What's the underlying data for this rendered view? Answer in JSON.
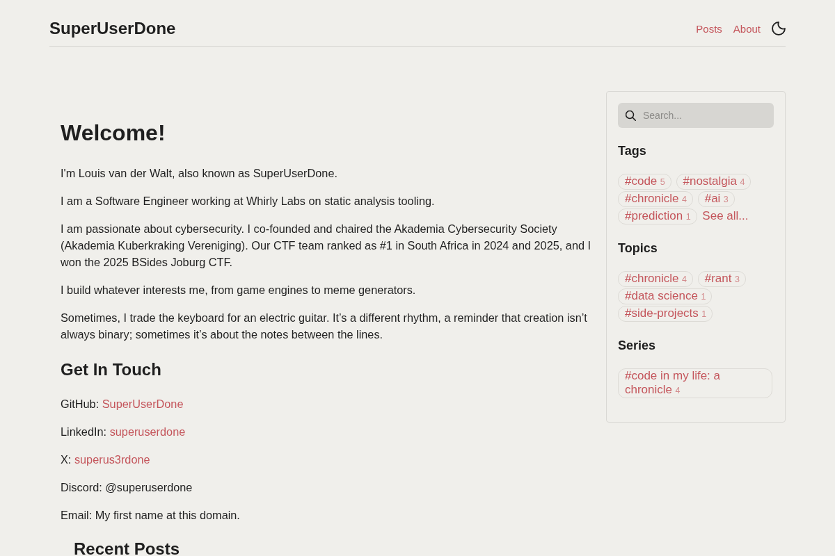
{
  "header": {
    "site_title": "SuperUserDone",
    "nav": [
      {
        "label": "Posts"
      },
      {
        "label": "About"
      }
    ]
  },
  "main": {
    "title": "Welcome!",
    "intro": [
      "I'm Louis van der Walt, also known as SuperUserDone.",
      "I am a Software Engineer working at Whirly Labs on static analysis tooling.",
      "I am passionate about cybersecurity. I co-founded and chaired the Akademia Cybersecurity Society (Akademia Kuberkraking Vereniging). Our CTF team ranked as #1 in South Africa in 2024 and 2025, and I won the 2025 BSides Joburg CTF.",
      "I build whatever interests me, from game engines to meme generators.",
      "Sometimes, I trade the keyboard for an electric guitar. It’s a different rhythm, a reminder that creation isn’t always binary; sometimes it’s about the notes between the lines."
    ],
    "contact": {
      "heading": "Get In Touch",
      "items": [
        {
          "label": "GitHub:",
          "value": "SuperUserDone",
          "kind": "link"
        },
        {
          "label": "LinkedIn:",
          "value": "superuserdone",
          "kind": "link"
        },
        {
          "label": "X:",
          "value": "superus3rdone",
          "kind": "link"
        },
        {
          "label": "Discord:",
          "value": "@superuserdone",
          "kind": "text"
        },
        {
          "label": "Email:",
          "value": "My first name at this domain.",
          "kind": "text"
        }
      ]
    },
    "recent_posts": {
      "heading": "Recent Posts"
    }
  },
  "sidebar": {
    "search": {
      "placeholder": "Search..."
    },
    "sections": [
      {
        "title": "Tags",
        "tags": [
          {
            "name": "#code",
            "count": "5"
          },
          {
            "name": "#nostalgia",
            "count": "4"
          },
          {
            "name": "#chronicle",
            "count": "4"
          },
          {
            "name": "#ai",
            "count": "3"
          },
          {
            "name": "#prediction",
            "count": "1"
          }
        ],
        "see_all": "See all..."
      },
      {
        "title": "Topics",
        "tags": [
          {
            "name": "#chronicle",
            "count": "4"
          },
          {
            "name": "#rant",
            "count": "3"
          },
          {
            "name": "#data science",
            "count": "1"
          },
          {
            "name": "#side-projects",
            "count": "1"
          }
        ]
      },
      {
        "title": "Series",
        "tags": [
          {
            "name": "#code in my life: a chronicle",
            "count": "4"
          }
        ]
      }
    ]
  }
}
